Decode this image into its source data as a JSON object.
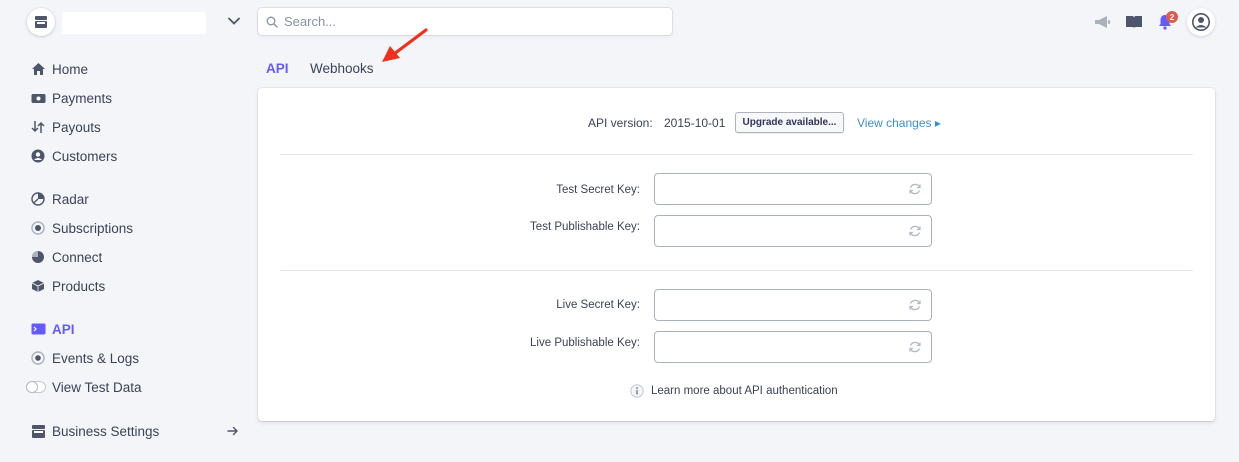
{
  "search": {
    "placeholder": "Search..."
  },
  "notifications": {
    "count": "2"
  },
  "sidebar": {
    "items": [
      {
        "label": "Home",
        "icon": "home-icon"
      },
      {
        "label": "Payments",
        "icon": "payments-icon"
      },
      {
        "label": "Payouts",
        "icon": "payouts-icon"
      },
      {
        "label": "Customers",
        "icon": "customers-icon"
      },
      {
        "label": "Radar",
        "icon": "radar-icon"
      },
      {
        "label": "Subscriptions",
        "icon": "subscriptions-icon"
      },
      {
        "label": "Connect",
        "icon": "connect-icon"
      },
      {
        "label": "Products",
        "icon": "products-icon"
      },
      {
        "label": "API",
        "icon": "api-icon",
        "active": true
      },
      {
        "label": "Events & Logs",
        "icon": "events-icon"
      },
      {
        "label": "View Test Data",
        "icon": "toggle-switch"
      },
      {
        "label": "Business Settings",
        "icon": "business-icon"
      }
    ]
  },
  "tabs": [
    {
      "label": "API",
      "active": true
    },
    {
      "label": "Webhooks",
      "active": false
    }
  ],
  "api": {
    "version_label": "API version:",
    "version_value": "2015-10-01",
    "upgrade_label": "Upgrade available...",
    "view_changes_label": "View changes ▸",
    "keys": [
      {
        "label": "Test Secret Key:",
        "value": ""
      },
      {
        "label": "Test Publishable Key:",
        "value": ""
      },
      {
        "label": "Live Secret Key:",
        "value": ""
      },
      {
        "label": "Live Publishable Key:",
        "value": ""
      }
    ],
    "learn_more": "Learn more about API authentication"
  },
  "colors": {
    "accent": "#635bff",
    "link": "#3d8fd1",
    "badge": "#e25950",
    "annotation_arrow": "#f0301e",
    "background": "#f4f5f9"
  }
}
